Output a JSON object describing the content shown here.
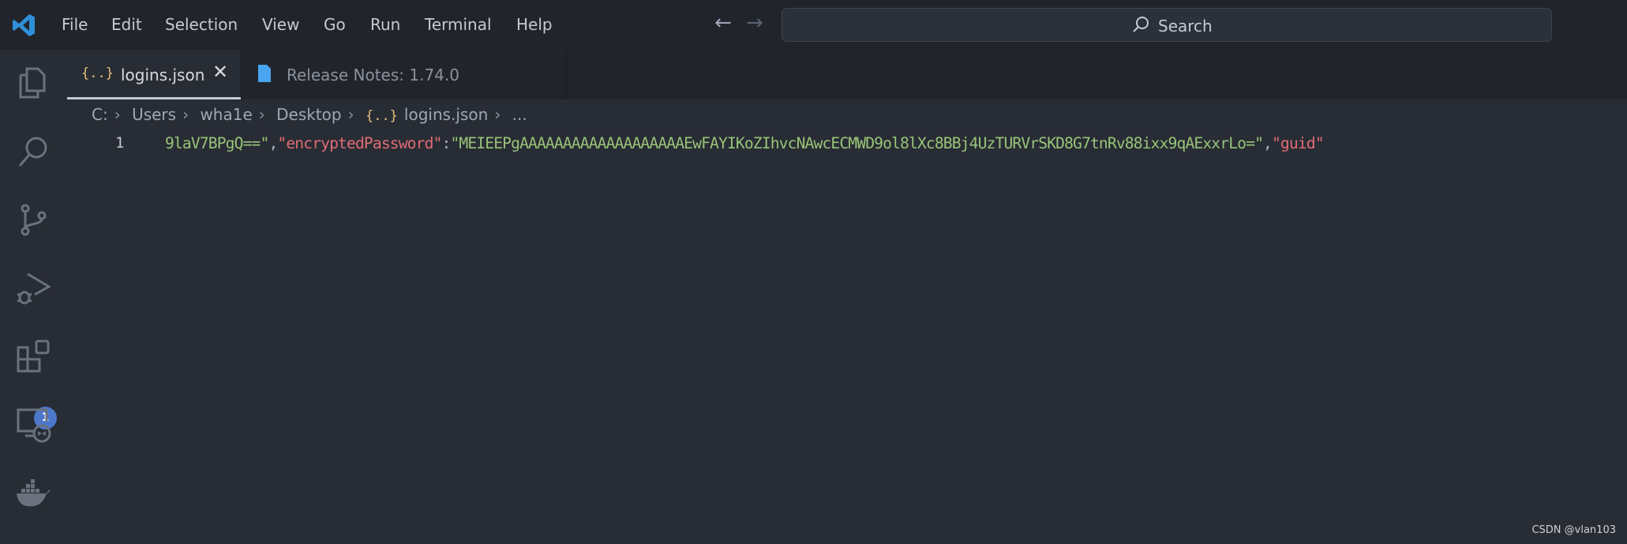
{
  "menubar": {
    "items": [
      "File",
      "Edit",
      "Selection",
      "View",
      "Go",
      "Run",
      "Terminal",
      "Help"
    ],
    "search_label": "Search"
  },
  "activity_bar": {
    "items": [
      "explorer",
      "search",
      "source-control",
      "run-and-debug",
      "extensions",
      "remote-explorer",
      "docker"
    ],
    "extensions_badge": "1"
  },
  "tabs": [
    {
      "label": "logins.json",
      "active": true
    },
    {
      "label": "Release Notes: 1.74.0",
      "active": false
    }
  ],
  "breadcrumb": [
    "C:",
    "Users",
    "wha1e",
    "Desktop",
    "logins.json",
    "..."
  ],
  "editor": {
    "line_number": "1",
    "tokens": [
      {
        "t": "9laV7BPgQ==\"",
        "c": "s"
      },
      {
        "t": ",",
        "c": "p"
      },
      {
        "t": "\"encryptedPassword\"",
        "c": "k"
      },
      {
        "t": ":",
        "c": "p"
      },
      {
        "t": "\"MEIEEPgAAAAAAAAAAAAAAAAAAAEwFAYIKoZIhvcNAwcECMWD9ol8lXc8BBj4UzTURVrSKD8G7tnRv88ixx9qAExxrLo=\"",
        "c": "s"
      },
      {
        "t": ",",
        "c": "p"
      },
      {
        "t": "\"guid\"",
        "c": "k"
      }
    ]
  },
  "watermark": "CSDN @vlan103",
  "colors": {
    "editor_bg": "#282c34",
    "titlebar_bg": "#21252b",
    "string": "#98c379",
    "key": "#e06c75",
    "badge": "#4d78cc"
  }
}
